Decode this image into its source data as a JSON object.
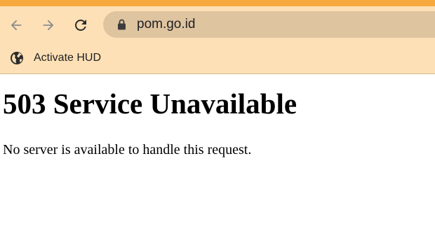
{
  "browser": {
    "colors": {
      "frame_accent": "#f6aa3d",
      "toolbar_bg": "#fde0b5",
      "omnibox_bg": "#dfc4a0"
    },
    "toolbar": {
      "back_icon": "arrow-left-icon",
      "forward_icon": "arrow-right-icon",
      "reload_icon": "reload-icon",
      "lock_icon": "lock-icon",
      "url": "pom.go.id"
    },
    "bookmarks": [
      {
        "label": "Activate HUD",
        "icon": "globe-icon"
      }
    ]
  },
  "page": {
    "heading": "503 Service Unavailable",
    "message": "No server is available to handle this request."
  }
}
